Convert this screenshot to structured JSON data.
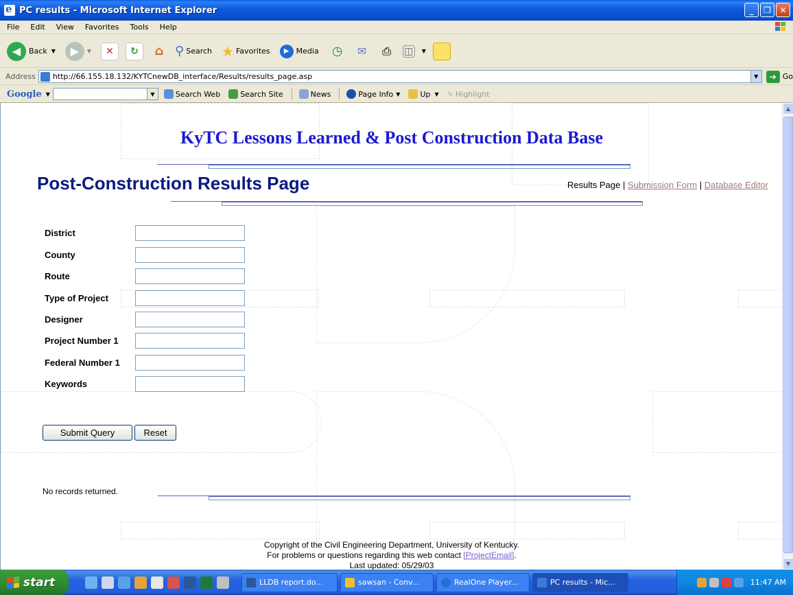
{
  "window": {
    "title": "PC results - Microsoft Internet Explorer"
  },
  "menu": [
    "File",
    "Edit",
    "View",
    "Favorites",
    "Tools",
    "Help"
  ],
  "toolbar": {
    "back": "Back",
    "search": "Search",
    "favorites": "Favorites",
    "media": "Media"
  },
  "address": {
    "label": "Address",
    "url": "http://66.155.18.132/KYTCnewDB_interface/Results/results_page.asp",
    "go": "Go"
  },
  "googlebar": {
    "logo": "Google",
    "search_web": "Search Web",
    "search_site": "Search Site",
    "news": "News",
    "page_info": "Page Info",
    "up": "Up",
    "highlight": "Highlight"
  },
  "page": {
    "site_title": "KyTC Lessons Learned & Post Construction Data Base",
    "heading": "Post-Construction Results Page",
    "nav_current": "Results Page",
    "nav_sep": "|",
    "nav_submission": "Submission Form",
    "nav_editor": "Database Editor",
    "fields": [
      {
        "label": "District",
        "value": ""
      },
      {
        "label": "County",
        "value": ""
      },
      {
        "label": "Route",
        "value": ""
      },
      {
        "label": "Type of Project",
        "value": ""
      },
      {
        "label": "Designer",
        "value": ""
      },
      {
        "label": "Project Number 1",
        "value": ""
      },
      {
        "label": "Federal Number 1",
        "value": ""
      },
      {
        "label": "Keywords",
        "value": ""
      }
    ],
    "submit": "Submit Query",
    "reset": "Reset",
    "no_records": "No records returned.",
    "footer_line1": "Copyright of the Civil Engineering Department, University of Kentucky.",
    "footer_line2_prefix": "For problems or questions regarding this web contact ",
    "footer_link": "[ProjectEmail]",
    "footer_line2_suffix": ".",
    "footer_line3": "Last updated: 05/29/03"
  },
  "taskbar": {
    "start": "start",
    "tasks": [
      {
        "label": "LLDB report.do...",
        "color": "#2b579a"
      },
      {
        "label": "sawsan - Conv...",
        "color": "#f0c030"
      },
      {
        "label": "RealOne Player...",
        "color": "#2a6fd6"
      },
      {
        "label": "PC results - Mic...",
        "color": "#3a7bd5"
      }
    ],
    "clock": "11:47 AM"
  }
}
